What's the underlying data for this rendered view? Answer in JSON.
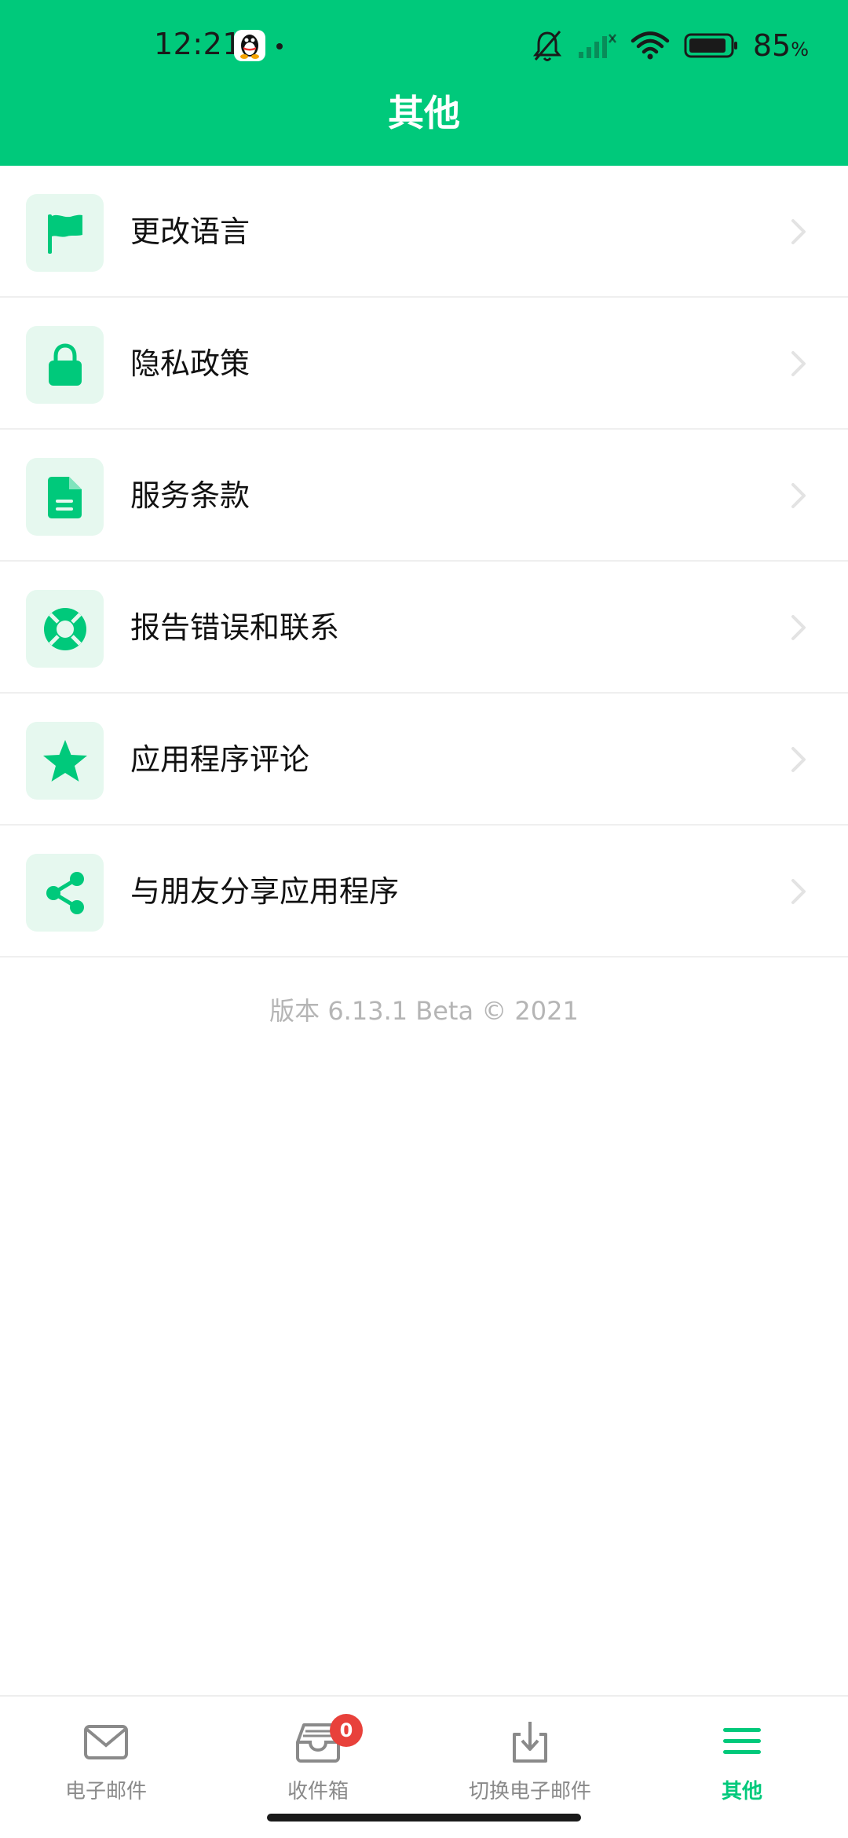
{
  "status_bar": {
    "time": "12:21",
    "battery": "85",
    "battery_unit": "%"
  },
  "header": {
    "title": "其他"
  },
  "menu": {
    "items": [
      {
        "label": "更改语言",
        "icon": "flag-icon"
      },
      {
        "label": "隐私政策",
        "icon": "lock-icon"
      },
      {
        "label": "服务条款",
        "icon": "document-icon"
      },
      {
        "label": "报告错误和联系",
        "icon": "lifebuoy-icon"
      },
      {
        "label": "应用程序评论",
        "icon": "star-icon"
      },
      {
        "label": "与朋友分享应用程序",
        "icon": "share-icon"
      }
    ]
  },
  "version_text": "版本 6.13.1 Beta © 2021",
  "bottom_nav": {
    "items": [
      {
        "label": "电子邮件",
        "icon": "mail-icon"
      },
      {
        "label": "收件箱",
        "icon": "inbox-icon",
        "badge": "0"
      },
      {
        "label": "切换电子邮件",
        "icon": "download-icon"
      },
      {
        "label": "其他",
        "icon": "menu-icon",
        "active": true
      }
    ]
  },
  "colors": {
    "accent": "#00c97b",
    "icon_bg": "#e6f8ef",
    "badge": "#e8413b"
  }
}
